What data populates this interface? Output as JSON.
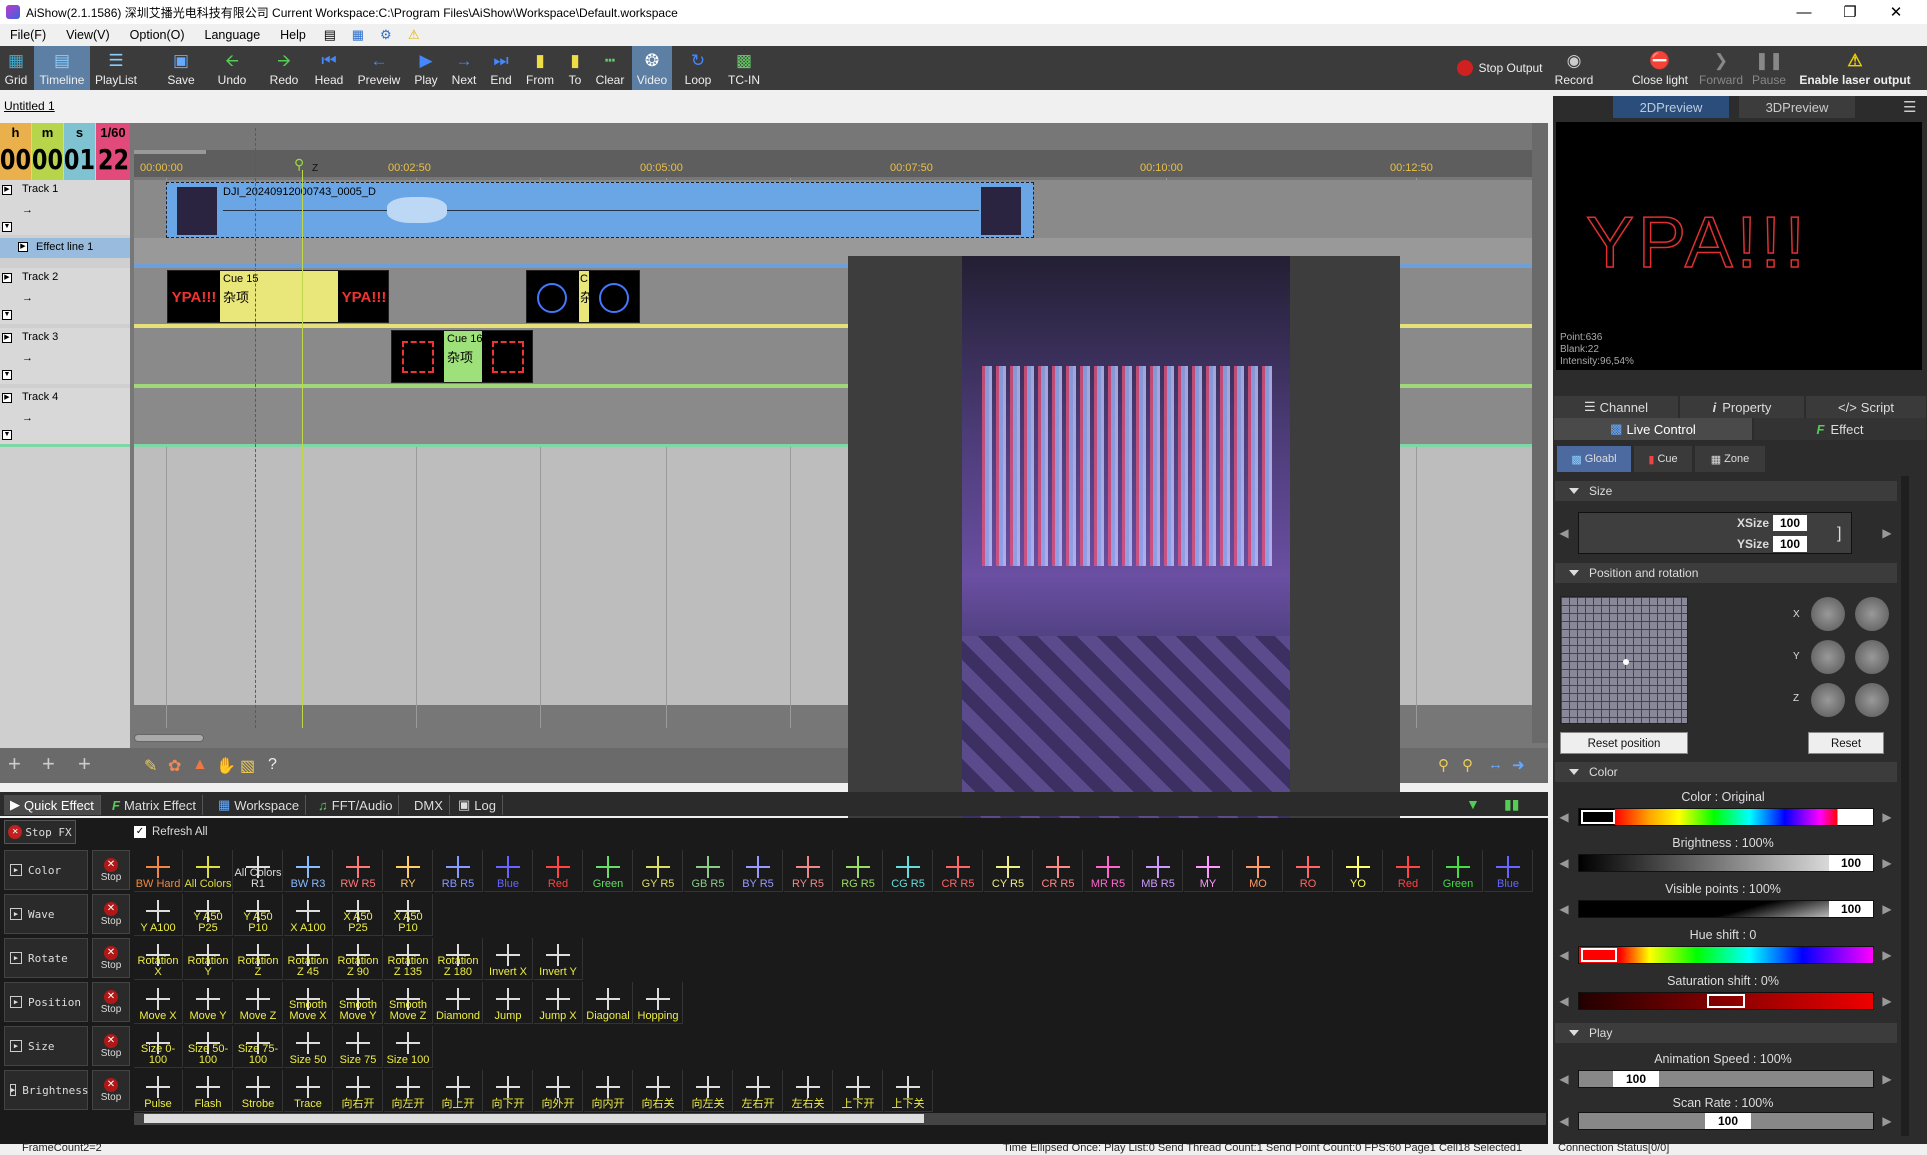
{
  "window": {
    "title": "AiShow(2.1.1586) 深圳艾播光电科技有限公司 Current Workspace:C:\\Program Files\\AiShow\\Workspace\\Default.workspace"
  },
  "menu": {
    "file": "File(F)",
    "view": "View(V)",
    "option": "Option(O)",
    "language": "Language",
    "help": "Help"
  },
  "toolbar": {
    "grid": "Grid",
    "timeline": "Timeline",
    "playlist": "PlayList",
    "save": "Save",
    "undo": "Undo",
    "redo": "Redo",
    "head": "Head",
    "preview": "Preveiw",
    "play": "Play",
    "next": "Next",
    "end": "End",
    "from": "From",
    "to": "To",
    "clear": "Clear",
    "video": "Video",
    "loop": "Loop",
    "tcin": "TC-IN",
    "stop_output": "Stop Output",
    "record": "Record",
    "close_light": "Close light",
    "forward": "Forward",
    "pause": "Pause",
    "enable_laser": "Enable laser output"
  },
  "document": {
    "tab": "Untitled 1"
  },
  "time": {
    "h_label": "h",
    "m_label": "m",
    "s_label": "s",
    "f_label": "1/60",
    "h": "00",
    "m": "00",
    "s": "01",
    "f": "22"
  },
  "ruler": {
    "labels": [
      "00:00:00",
      "00:02:50",
      "00:05:00",
      "00:07:50",
      "00:10:00",
      "00:12:50"
    ],
    "marker": "Z"
  },
  "tracks": [
    {
      "name": "Track 1",
      "clip": "DJI_20240912000743_0005_D"
    },
    {
      "name": "Effect line 1"
    },
    {
      "name": "Track 2"
    },
    {
      "name": "Track 3"
    },
    {
      "name": "Track 4"
    }
  ],
  "cues": {
    "cue15_title": "Cue 15",
    "cue15_sub": "杂项",
    "cue15_text": "YPA!!!",
    "cue_b_title": "C",
    "cue_b_sub": "杂",
    "cue16_title": "Cue 16",
    "cue16_sub": "杂项"
  },
  "preview": {
    "tab2d": "2DPreview",
    "tab3d": "3DPreview",
    "text": "YPA!!!",
    "point": "Point:636",
    "blank": "Blank:22",
    "intensity": "Intensity:96,54%"
  },
  "right": {
    "channel": "Channel",
    "property": "Property",
    "script": "Script",
    "live_control": "Live Control",
    "effect": "Effect",
    "global": "Gloabl",
    "cue": "Cue",
    "zone": "Zone",
    "size": "Size",
    "xsize_label": "XSize",
    "xsize": "100",
    "ysize_label": "YSize",
    "ysize": "100",
    "pos_rot": "Position and rotation",
    "reset_position": "Reset position",
    "reset": "Reset",
    "x": "X",
    "y": "Y",
    "z": "Z",
    "color": "Color",
    "color_label": "Color : Original",
    "brightness_label": "Brightness : 100%",
    "brightness": "100",
    "visible_label": "Visible points : 100%",
    "visible": "100",
    "hue_label": "Hue shift : 0",
    "saturation_label": "Saturation shift : 0%",
    "play": "Play",
    "anim_label": "Animation Speed : 100%",
    "anim": "100",
    "scan_label": "Scan Rate : 100%",
    "scan": "100"
  },
  "bottom_tabs": {
    "quick": "Quick Effect",
    "matrix": "Matrix Effect",
    "workspace": "Workspace",
    "fft": "FFT/Audio",
    "dmx": "DMX",
    "log": "Log"
  },
  "qfx": {
    "stop_fx": "Stop FX",
    "refresh": "Refresh All",
    "stop": "Stop",
    "rows": [
      {
        "label": "Color",
        "cells": [
          "BW Hard",
          "All Colors",
          "All Colors R1",
          "BW R3",
          "RW R5",
          "RY",
          "RB R5",
          "Blue",
          "Red",
          "Green",
          "GY R5",
          "GB R5",
          "BY R5",
          "RY R5",
          "RG R5",
          "CG R5",
          "CR R5",
          "CY R5",
          "CR R5",
          "MR R5",
          "MB R5",
          "MY",
          "MO",
          "RO",
          "YO",
          "Red",
          "Green",
          "Blue"
        ]
      },
      {
        "label": "Wave",
        "cells": [
          "Y A100",
          "Y A50 P25",
          "Y A50 P10",
          "X A100",
          "X A50 P25",
          "X A50 P10"
        ]
      },
      {
        "label": "Rotate",
        "cells": [
          "Rotation X",
          "Rotation Y",
          "Rotation Z",
          "Rotation Z 45",
          "Rotation Z 90",
          "Rotation Z 135",
          "Rotation Z 180",
          "Invert X",
          "Invert Y"
        ]
      },
      {
        "label": "Position",
        "cells": [
          "Move X",
          "Move Y",
          "Move Z",
          "Smooth Move X",
          "Smooth Move Y",
          "Smooth Move Z",
          "Diamond",
          "Jump",
          "Jump X",
          "Diagonal",
          "Hopping"
        ]
      },
      {
        "label": "Size",
        "cells": [
          "Size 0-100",
          "Size 50-100",
          "Size 75-100",
          "Size 50",
          "Size 75",
          "Size 100"
        ]
      },
      {
        "label": "Brightness",
        "cells": [
          "Pulse",
          "Flash",
          "Strobe",
          "Trace",
          "向右开",
          "向左开",
          "向上开",
          "向下开",
          "向外开",
          "向内开",
          "向右关",
          "向左关",
          "左右开",
          "左右关",
          "上下开",
          "上下关"
        ]
      }
    ]
  },
  "status": {
    "left": "FrameCount2=2",
    "right": "Time Ellipsed Once: Play List:0 Send Thread Count:1 Send Point Count:0 FPS:60  Page1 Cell18 Selected1",
    "conn": "Connection Status[0/0]"
  }
}
